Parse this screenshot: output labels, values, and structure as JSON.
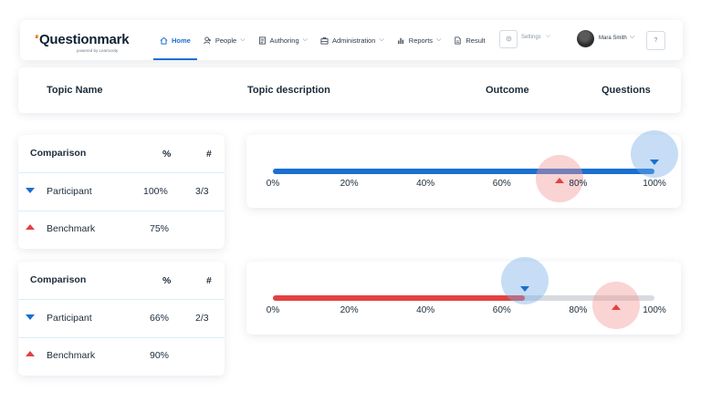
{
  "nav": {
    "logo": "Questionmark",
    "logo_sub": "powered by Learnosity",
    "items": [
      {
        "label": "Home",
        "icon": "home-icon"
      },
      {
        "label": "People",
        "icon": "people-icon"
      },
      {
        "label": "Authoring",
        "icon": "authoring-icon"
      },
      {
        "label": "Administration",
        "icon": "administration-icon"
      },
      {
        "label": "Reports",
        "icon": "reports-icon"
      },
      {
        "label": "Result",
        "icon": "result-icon"
      }
    ],
    "settings_label": "Settings",
    "user_name": "Mara Smith",
    "help": "?",
    "accent": "#1a6fd1"
  },
  "header": {
    "topic_name": "Topic Name",
    "topic_description": "Topic description",
    "outcome": "Outcome",
    "questions": "Questions"
  },
  "comparisons": [
    {
      "title": "Comparison",
      "col_pct": "%",
      "col_num": "#",
      "participant": {
        "label": "Participant",
        "pct": "100%",
        "num": "3/3"
      },
      "benchmark": {
        "label": "Benchmark",
        "pct": "75%",
        "num": ""
      },
      "fill_color": "#1a6fd1",
      "participant_value": 100,
      "benchmark_value": 75
    },
    {
      "title": "Comparison",
      "col_pct": "%",
      "col_num": "#",
      "participant": {
        "label": "Participant",
        "pct": "66%",
        "num": "2/3"
      },
      "benchmark": {
        "label": "Benchmark",
        "pct": "90%",
        "num": ""
      },
      "fill_color": "#e34141",
      "participant_value": 66,
      "benchmark_value": 90
    }
  ],
  "scale_ticks": [
    "0%",
    "20%",
    "40%",
    "60%",
    "80%",
    "100%"
  ],
  "colors": {
    "participant": "#1a6fd1",
    "benchmark": "#e34141"
  }
}
